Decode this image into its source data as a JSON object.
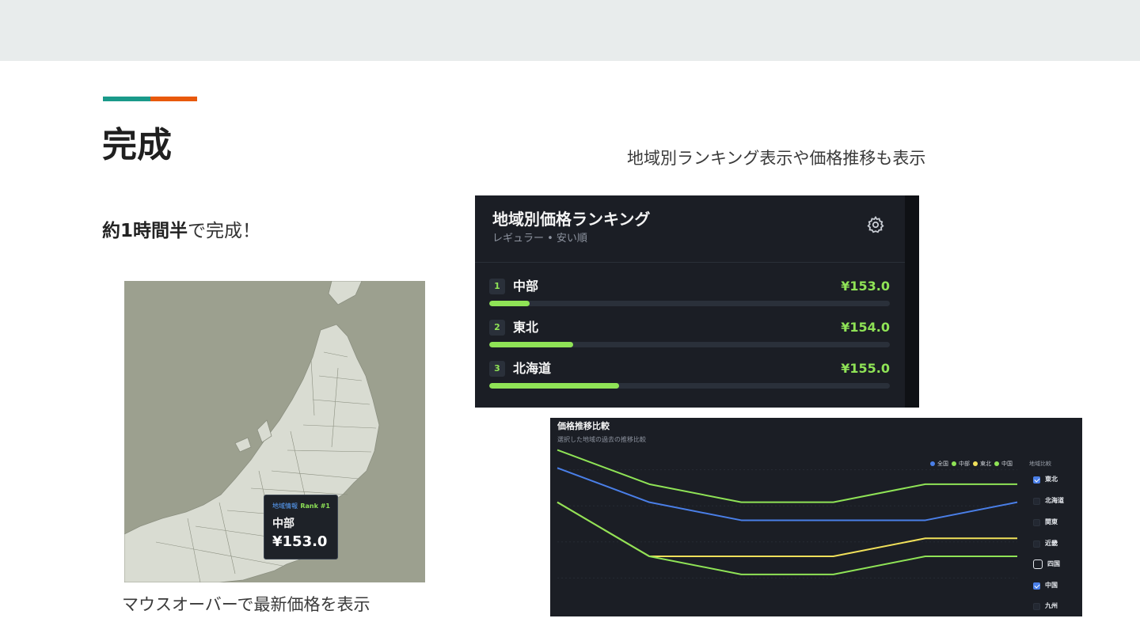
{
  "slide": {
    "title": "完成",
    "subhead_bold": "約1時間半",
    "subhead_rest": "で完成！",
    "caption_right": "地域別ランキング表示や価格推移も表示",
    "caption_map": "マウスオーバーで最新価格を表示",
    "accent_colors": [
      "#1a9a8a",
      "#e8590c"
    ]
  },
  "map_tooltip": {
    "header": "地域情報",
    "rank": "Rank #1",
    "region": "中部",
    "price": "¥153.0"
  },
  "ranking": {
    "title": "地域別価格ランキング",
    "subtitle": "レギュラー • 安い順",
    "settings_icon": "gear-icon",
    "accent": "#8fe356",
    "items": [
      {
        "rank": "1",
        "region": "中部",
        "price": "¥153.0",
        "bar_fraction": 0.1
      },
      {
        "rank": "2",
        "region": "東北",
        "price": "¥154.0",
        "bar_fraction": 0.21
      },
      {
        "rank": "3",
        "region": "北海道",
        "price": "¥155.0",
        "bar_fraction": 0.325
      }
    ]
  },
  "trend": {
    "title": "価格推移比較",
    "subtitle": "選択した地域の過去の推移比較",
    "compare_label": "地域比較",
    "legend": [
      {
        "name": "全国",
        "color": "#4a7fe8"
      },
      {
        "name": "中部",
        "color": "#8fe356"
      },
      {
        "name": "東北",
        "color": "#f0e05a"
      },
      {
        "name": "中国",
        "color": "#8fe356"
      }
    ],
    "regions": [
      {
        "name": "東北",
        "state": "checked"
      },
      {
        "name": "北海道",
        "state": "unchecked"
      },
      {
        "name": "関東",
        "state": "unchecked"
      },
      {
        "name": "近畿",
        "state": "unchecked"
      },
      {
        "name": "四国",
        "state": "focused"
      },
      {
        "name": "中国",
        "state": "checked"
      },
      {
        "name": "九州",
        "state": "unchecked"
      }
    ]
  },
  "chart_data": {
    "type": "line",
    "title": "価格推移比較",
    "x": [
      0,
      1,
      2,
      3,
      4,
      5
    ],
    "ylim": [
      0,
      10
    ],
    "grid": true,
    "legend_position": "top-right",
    "series": [
      {
        "name": "全国",
        "color": "#4a7fe8",
        "values": [
          8.1,
          6.2,
          5.2,
          5.2,
          5.2,
          6.2
        ]
      },
      {
        "name": "中部",
        "color": "#8fe356",
        "values": [
          9.1,
          7.2,
          6.2,
          6.2,
          7.2,
          7.2
        ]
      },
      {
        "name": "東北",
        "color": "#f0e05a",
        "values": [
          6.2,
          3.2,
          3.2,
          3.2,
          4.2,
          4.2
        ]
      },
      {
        "name": "中国",
        "color": "#8fe356",
        "values": [
          6.2,
          3.2,
          2.2,
          2.2,
          3.2,
          3.2
        ]
      }
    ]
  }
}
